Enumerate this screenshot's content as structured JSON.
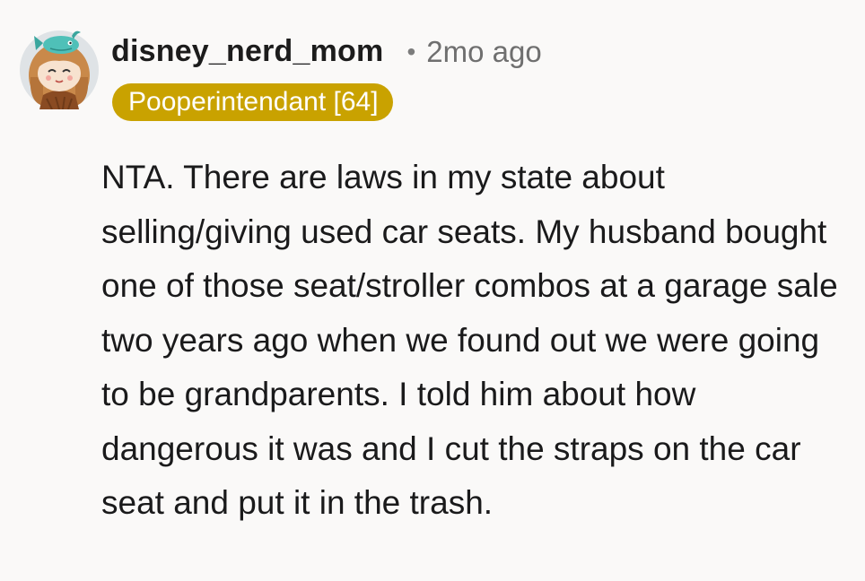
{
  "comment": {
    "author": "disney_nerd_mom",
    "separator": "•",
    "timestamp": "2mo ago",
    "flair": "Pooperintendant [64]",
    "body": "NTA. There are laws in my state about selling/giving used car seats. My husband bought one of those seat/stroller combos at a garage sale two years ago when we found out we were going to be grandparents. I told him about how dangerous it was and I cut the straps on the car seat and put it in the trash."
  },
  "colors": {
    "background": "#faf9f8",
    "flair_bg": "#c9a200",
    "text": "#1a1a1b",
    "meta": "#6f6f6f"
  },
  "icons": {
    "avatar": "snoo-avatar-icon"
  }
}
